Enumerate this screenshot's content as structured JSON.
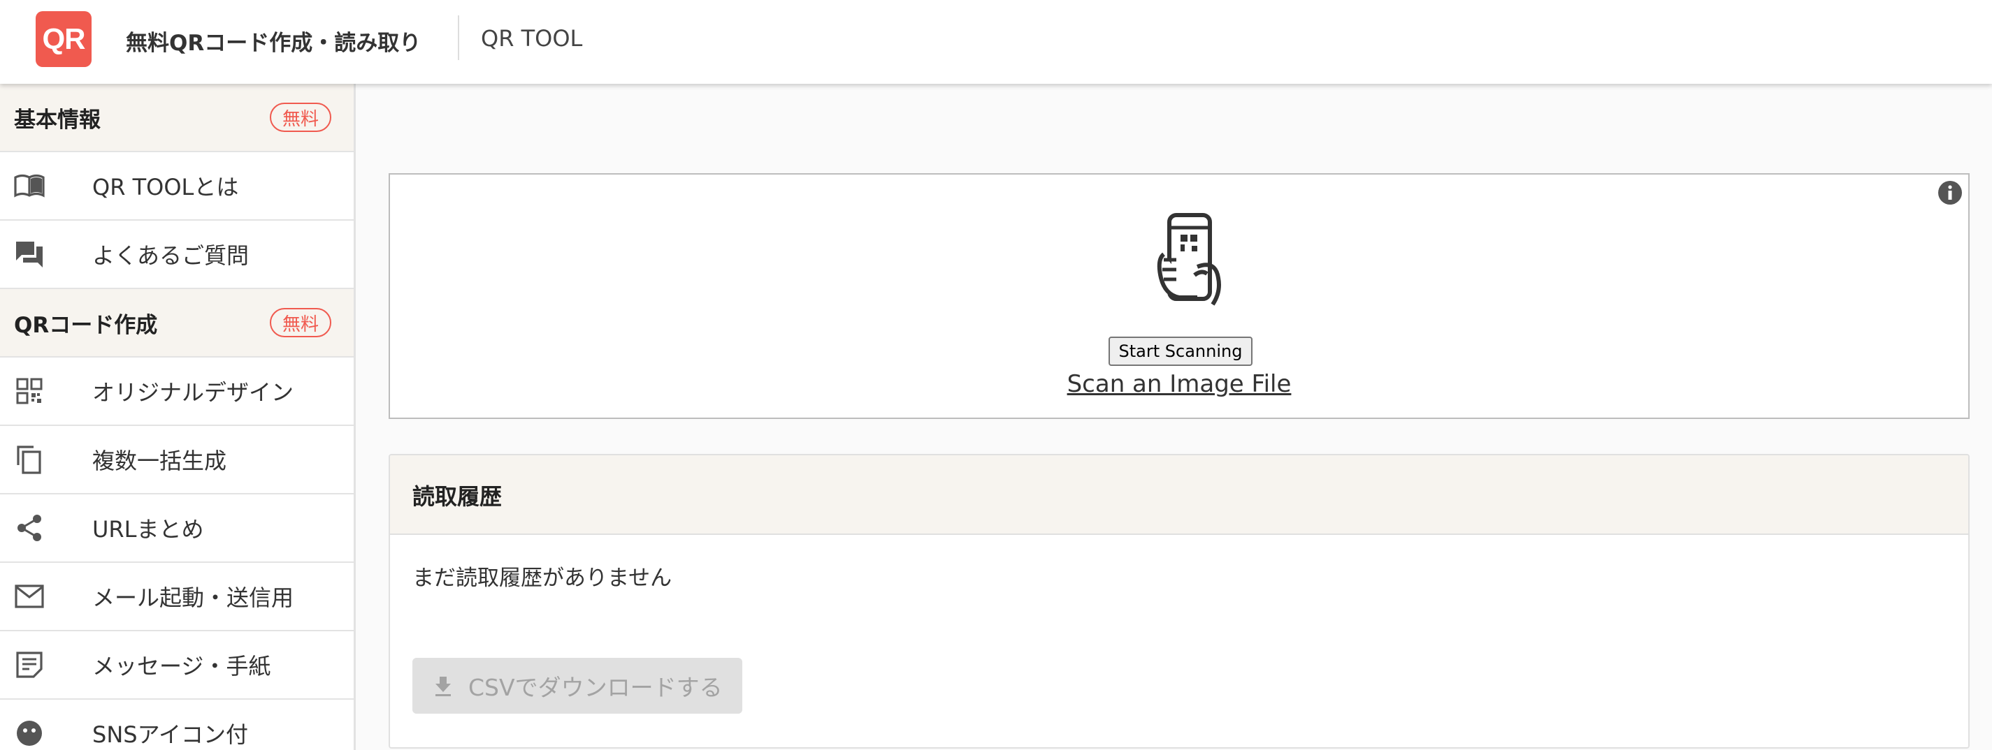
{
  "header": {
    "logo_text": "QR",
    "site_title": "無料QRコード作成・読み取り",
    "brand_name": "QR TOOL"
  },
  "sidebar": {
    "sections": [
      {
        "title": "基本情報",
        "badge": "無料",
        "items": [
          {
            "label": "QR TOOLとは",
            "icon": "book-icon"
          },
          {
            "label": "よくあるご質問",
            "icon": "chat-bubbles-icon"
          }
        ]
      },
      {
        "title": "QRコード作成",
        "badge": "無料",
        "items": [
          {
            "label": "オリジナルデザイン",
            "icon": "qr-code-icon"
          },
          {
            "label": "複数一括生成",
            "icon": "copy-icon"
          },
          {
            "label": "URLまとめ",
            "icon": "share-icon"
          },
          {
            "label": "メール起動・送信用",
            "icon": "mail-icon"
          },
          {
            "label": "メッセージ・手紙",
            "icon": "note-icon"
          },
          {
            "label": "SNSアイコン付",
            "icon": "smiley-icon"
          }
        ]
      }
    ]
  },
  "scanner": {
    "start_button": "Start Scanning",
    "scan_file_link": "Scan an Image File"
  },
  "history": {
    "title": "読取履歴",
    "empty_message": "まだ読取履歴がありません",
    "csv_button": "CSVでダウンロードする"
  },
  "colors": {
    "accent": "#f05a4f",
    "section_bg": "#f7f4ef",
    "disabled_bg": "#e0e0e0"
  }
}
